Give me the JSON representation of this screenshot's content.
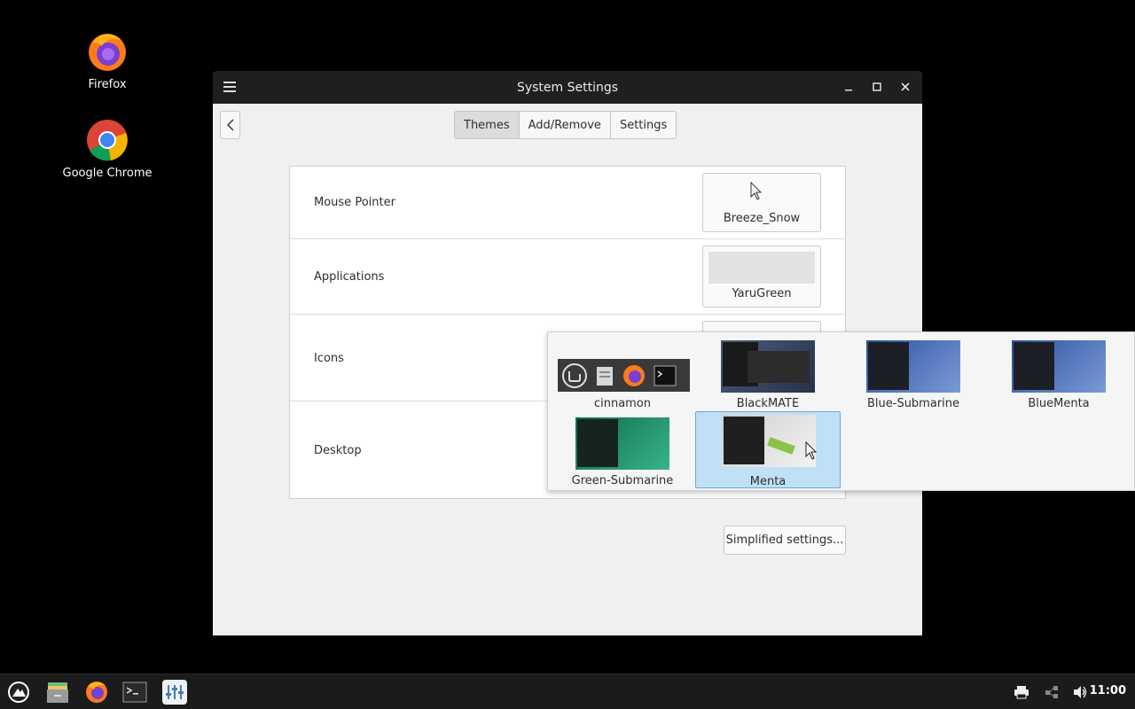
{
  "desktop": {
    "icons": [
      {
        "label": "Firefox"
      },
      {
        "label": "Google Chrome"
      }
    ]
  },
  "window": {
    "title": "System Settings",
    "tabs": [
      "Themes",
      "Add/Remove",
      "Settings"
    ],
    "active_tab": "Themes",
    "rows": [
      {
        "label": "Mouse Pointer",
        "value": "Breeze_Snow"
      },
      {
        "label": "Applications",
        "value": "YaruGreen"
      },
      {
        "label": "Icons",
        "value": ""
      },
      {
        "label": "Desktop",
        "value": ""
      }
    ],
    "simplified_button": "Simplified settings..."
  },
  "popup": {
    "items": [
      {
        "name": "cinnamon"
      },
      {
        "name": "BlackMATE"
      },
      {
        "name": "Blue-Submarine"
      },
      {
        "name": "BlueMenta"
      },
      {
        "name": "Green-Submarine"
      },
      {
        "name": "Menta",
        "selected": true
      }
    ]
  },
  "taskbar": {
    "clock": "11:00",
    "apps": [
      "menu-icon",
      "files-icon",
      "firefox-icon",
      "terminal-icon",
      "settings-app-icon"
    ],
    "tray": [
      "printer-icon",
      "network-icon",
      "volume-icon"
    ]
  },
  "colors": {
    "selection": "#bfe0f5",
    "selection_border": "#6aa9d6",
    "titlebar": "#1f1f1f",
    "taskbar": "#1b1b1b"
  }
}
